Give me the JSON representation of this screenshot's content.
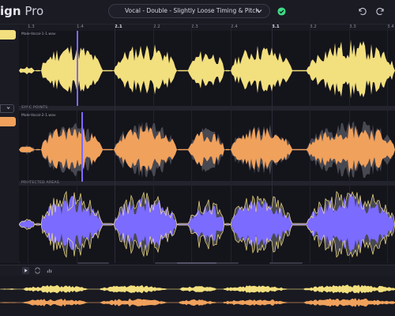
{
  "app": {
    "title_bold": "ign",
    "title_light": " Pro"
  },
  "preset": {
    "label": "Vocal - Double - Slightly Loose Timing & Pitch"
  },
  "ruler": {
    "marks": [
      "1.3",
      "1.4",
      "2.1",
      "2.2",
      "2.3",
      "2.4",
      "3.1",
      "3.2",
      "3.3",
      "3.4"
    ]
  },
  "tracks": [
    {
      "filename": "Male-Vocal-1-1.wav",
      "color": "#f2df7e"
    },
    {
      "section_label": "SYNC POINTS",
      "filename": "Male-Vocal-2-1.wav",
      "color": "#f0a15c"
    },
    {
      "section_label": "PROTECTED AREAS",
      "color": "#7b6bff"
    }
  ],
  "colors": {
    "accent": "#7b6bff",
    "status_ok": "#3ddc84"
  },
  "icons": [
    "chevron-down-icon",
    "check-circle-icon",
    "undo-icon",
    "redo-icon",
    "play-icon",
    "loop-icon",
    "bars-icon"
  ]
}
